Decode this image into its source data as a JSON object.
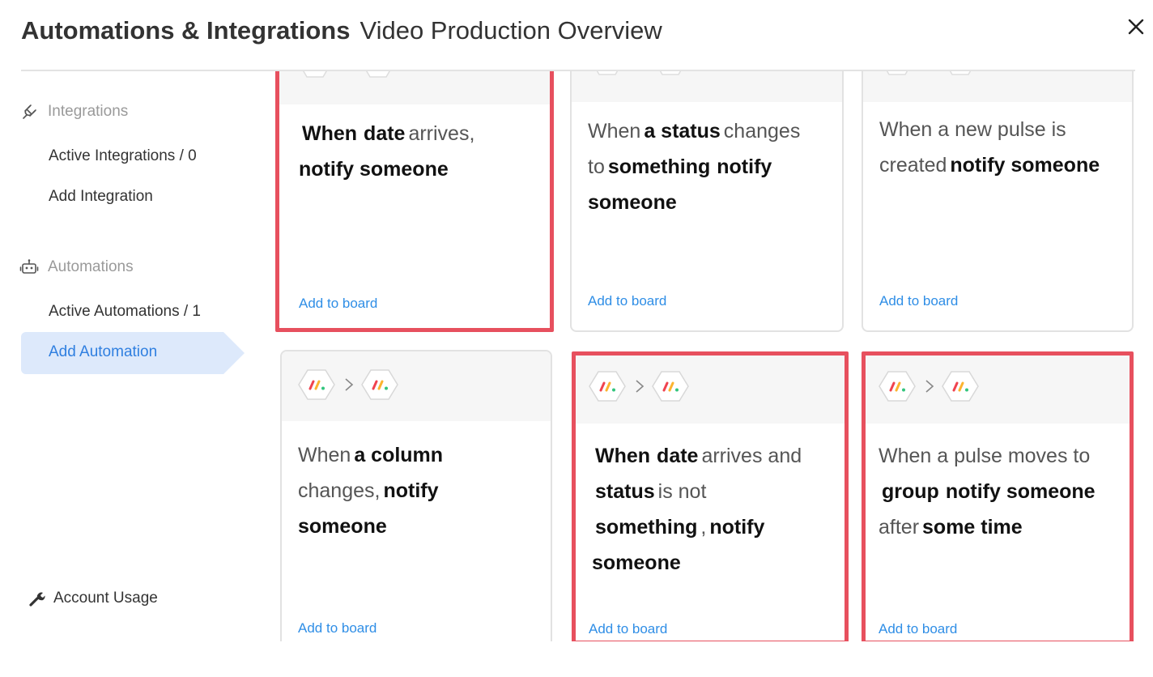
{
  "header": {
    "title": "Automations & Integrations",
    "subtitle": "Video Production Overview"
  },
  "sidebar": {
    "integrations": {
      "heading": "Integrations",
      "items": [
        {
          "label": "Active Integrations / 0"
        },
        {
          "label": "Add Integration"
        }
      ]
    },
    "automations": {
      "heading": "Automations",
      "items": [
        {
          "label": "Active Automations / 1"
        },
        {
          "label": "Add Automation"
        }
      ]
    },
    "account_usage": "Account Usage"
  },
  "add_label": "Add to board",
  "cards": [
    {
      "parts": [
        [
          "b",
          "When"
        ],
        [
          "t",
          "date"
        ],
        [
          "b",
          ""
        ],
        [
          "t",
          "arrives,"
        ]
      ],
      "highlighted": true
    },
    {
      "highlighted": false
    },
    {
      "highlighted": false
    },
    {
      "highlighted": false
    },
    {
      "highlighted": true
    },
    {
      "highlighted": true
    }
  ],
  "card_text": {
    "c1": {
      "w1": "When",
      "w2": "date",
      "w3": "arrives,",
      "w4": "notify someone"
    },
    "c2": {
      "w1": "When",
      "w2": "a status",
      "w3": "changes",
      "w4": "to",
      "w5": "something",
      "w6": "notify",
      "w7": "someone"
    },
    "c3": {
      "w1": "When a new pulse is",
      "w2": "created",
      "w3": "notify someone"
    },
    "c4": {
      "w1": "When",
      "w2": "a column",
      "w3": "changes,",
      "w4": "notify",
      "w5": "someone"
    },
    "c5": {
      "w1": "When",
      "w2": "date",
      "w3": "arrives and",
      "w4": "status",
      "w5": "is not",
      "w6": "something",
      "w7": ",",
      "w8": "notify",
      "w9": "someone"
    },
    "c6": {
      "w1": "When a pulse moves to",
      "w2": "group",
      "w3": "notify someone",
      "w4": "after",
      "w5": "some time"
    }
  },
  "icons": {
    "integrations": "plug-icon",
    "automations": "robot-icon",
    "account": "wrench-icon",
    "close": "close-icon",
    "app": "monday-logo-icon",
    "chevron": "chevron-right-icon"
  },
  "colors": {
    "accent": "#2f8ee6",
    "highlight": "#e7505e",
    "active_nav": "#dde9fb"
  }
}
